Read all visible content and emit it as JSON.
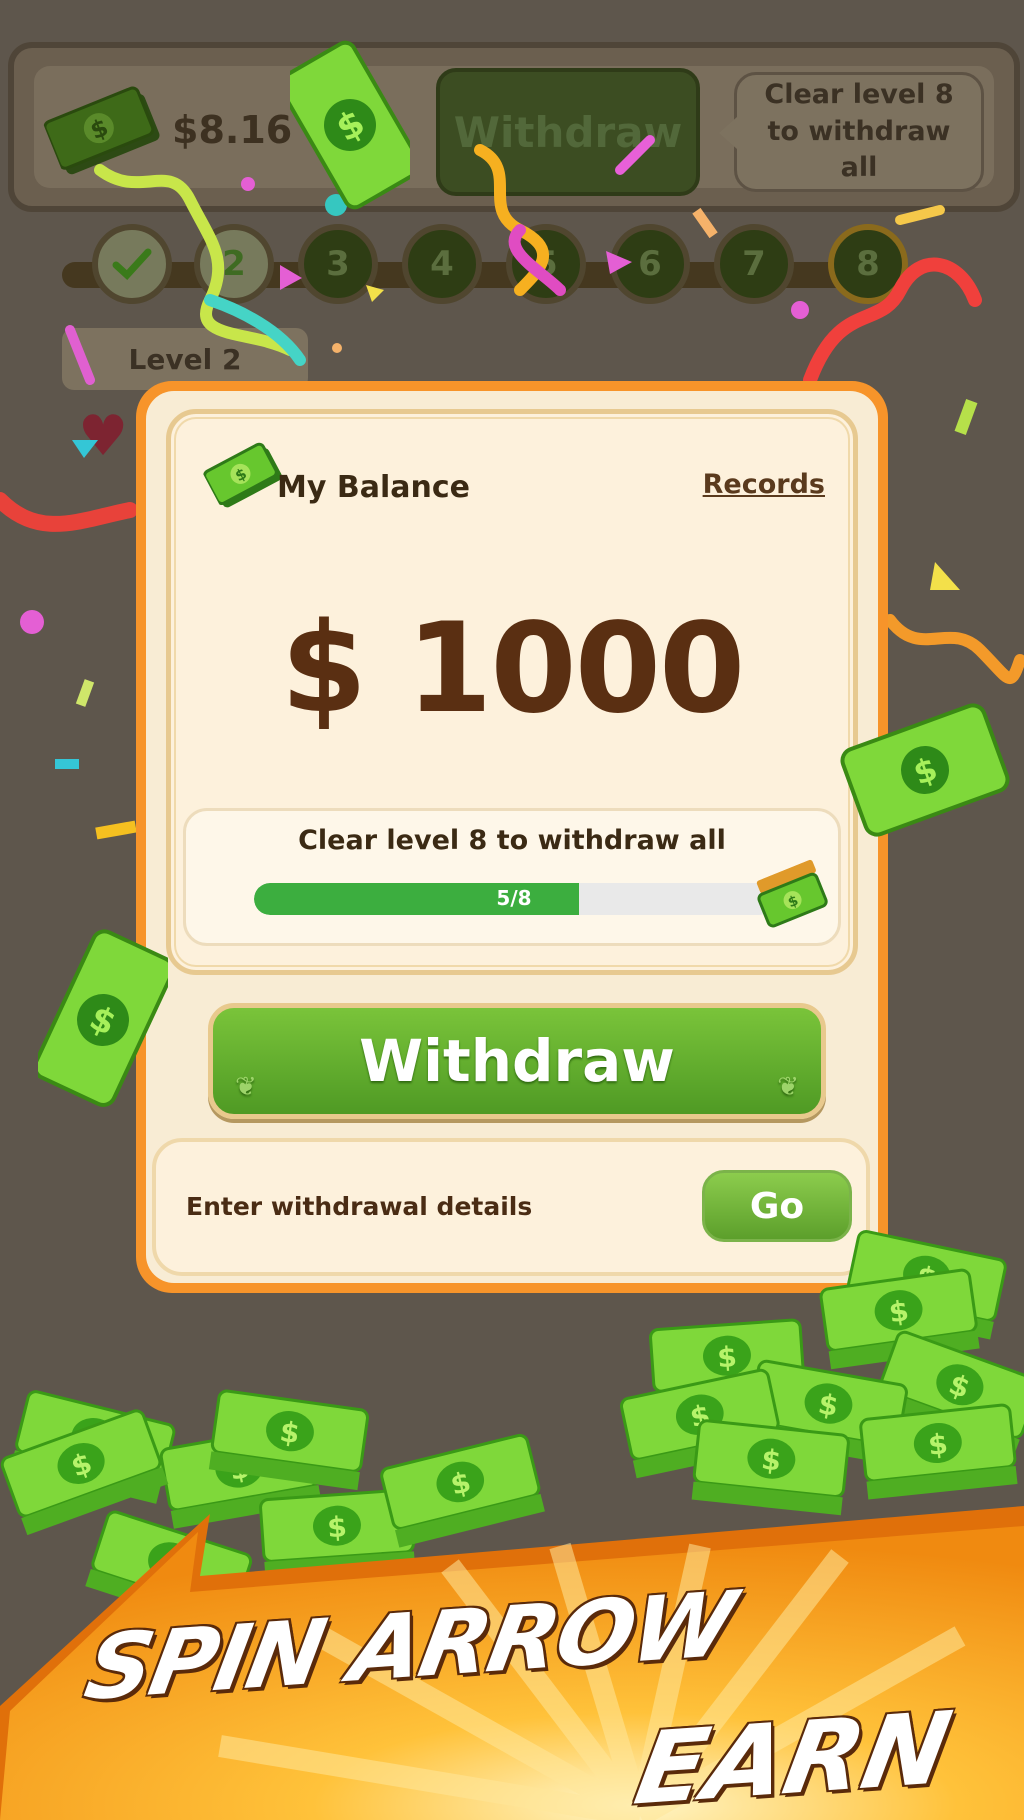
{
  "hud": {
    "balance": "$8.16",
    "withdraw_label": "Withdraw",
    "tip": "Clear level 8 to withdraw all",
    "levels": [
      "2",
      "3",
      "4",
      "5",
      "6",
      "7",
      "8"
    ],
    "current_level_label": "Level 2"
  },
  "card": {
    "title": "My Balance",
    "records_label": "Records",
    "amount": "$ 1000",
    "progress_caption": "Clear level 8 to withdraw all",
    "progress_text": "5/8",
    "progress_fraction": 0.625,
    "withdraw_label": "Withdraw",
    "details_label": "Enter withdrawal details",
    "go_label": "Go"
  },
  "banner": {
    "line1": "SPIN ARROW",
    "line2": "EARN"
  },
  "colors": {
    "background": "#5e564c",
    "card_border": "#f7942a",
    "card_fill": "#f8ecd4",
    "amount": "#5a2f12",
    "progress_fill": "#3cae3f",
    "button_green": "#5a9f2b",
    "banner_orange": "#ff9f1a"
  },
  "icons": [
    "cash-icon",
    "check-icon",
    "heart-icon",
    "leaf-icon"
  ]
}
